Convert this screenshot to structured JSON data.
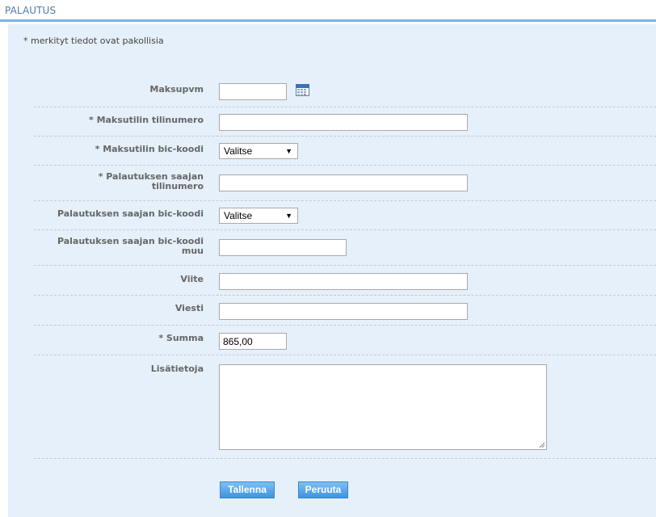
{
  "header": {
    "title": "PALAUTUS"
  },
  "form": {
    "required_note": "* merkityt tiedot ovat pakollisia",
    "fields": {
      "maksupvm": {
        "label": "Maksupvm",
        "value": ""
      },
      "maksutilin_tilinumero": {
        "label": "* Maksutilin tilinumero",
        "value": ""
      },
      "maksutilin_bic": {
        "label": "* Maksutilin bic-koodi",
        "selected": "Valitse"
      },
      "saajan_tilinumero": {
        "label_line1": "* Palautuksen saajan",
        "label_line2": "tilinumero",
        "value": ""
      },
      "saajan_bic": {
        "label": "Palautuksen saajan bic-koodi",
        "selected": "Valitse"
      },
      "saajan_bic_muu": {
        "label_line1": "Palautuksen saajan bic-koodi",
        "label_line2": "muu",
        "value": ""
      },
      "viite": {
        "label": "Viite",
        "value": ""
      },
      "viesti": {
        "label": "Viesti",
        "value": ""
      },
      "summa": {
        "label": "* Summa",
        "value": "865,00"
      },
      "lisatietoja": {
        "label": "Lisätietoja",
        "value": ""
      }
    },
    "buttons": {
      "save": "Tallenna",
      "cancel": "Peruuta"
    }
  },
  "icons": {
    "date_picker": "calendar-icon",
    "dropdown": "triangle-down-icon",
    "resize": "resize-grip-icon"
  },
  "colors": {
    "panel_bg": "#e6f0fa",
    "header_rule": "#7fb3de",
    "button": "#3f93dd"
  }
}
